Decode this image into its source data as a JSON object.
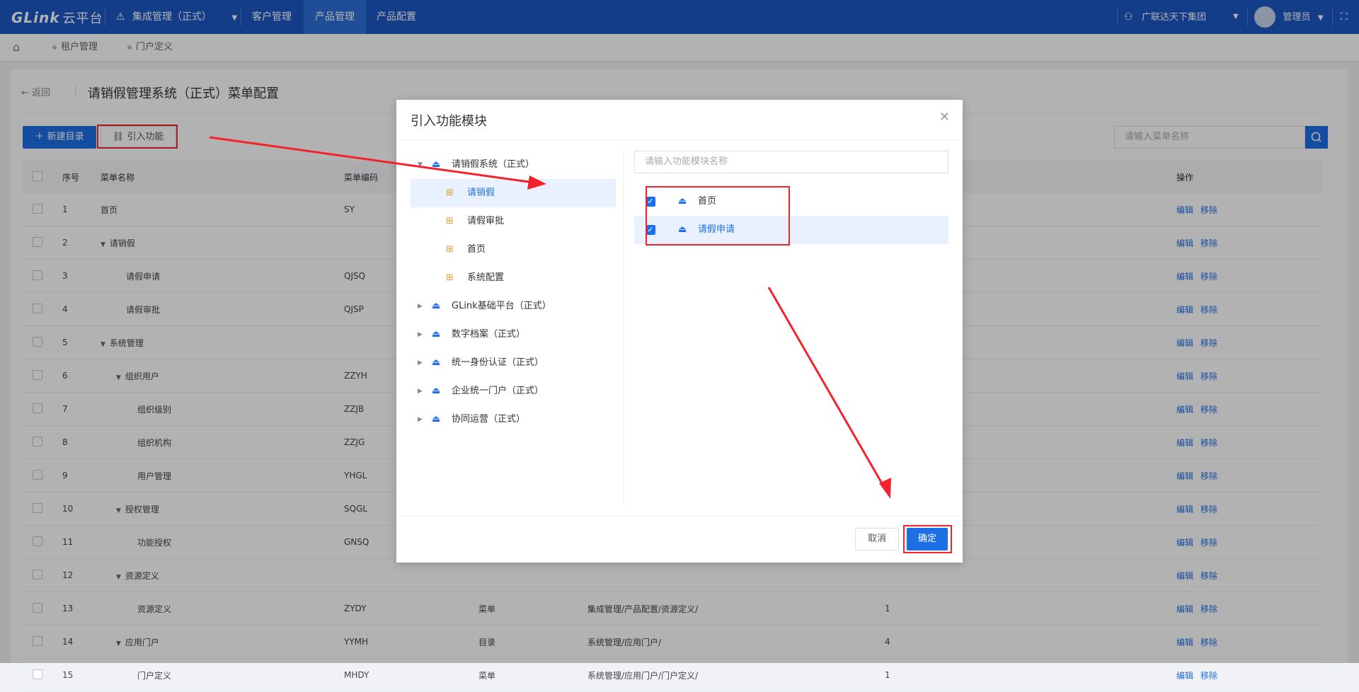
{
  "topbar": {
    "logo": "GLink",
    "logo_suffix": "云平台",
    "app_switch": "集成管理（正式）",
    "nav": [
      "客户管理",
      "产品管理",
      "产品配置"
    ],
    "active_nav": "产品管理",
    "org": "广联达天下集团",
    "user": "管理员"
  },
  "tabs": [
    "租户管理",
    "门户定义"
  ],
  "page": {
    "back": "返回",
    "title": "请销假管理系统（正式）菜单配置",
    "new_btn": "新建目录",
    "import_btn": "引入功能",
    "search_placeholder": "请输入菜单名称"
  },
  "table": {
    "headers": [
      "序号",
      "菜单名称",
      "菜单编码",
      "",
      "",
      "",
      "操作"
    ],
    "rows": [
      {
        "no": "1",
        "name": "首页",
        "level": 0,
        "expand": false,
        "code": "SY",
        "type": "",
        "path": "",
        "sort": ""
      },
      {
        "no": "2",
        "name": "请销假",
        "level": 0,
        "expand": true,
        "code": "",
        "type": "",
        "path": "",
        "sort": ""
      },
      {
        "no": "3",
        "name": "请假申请",
        "level": 1,
        "expand": false,
        "code": "QJSQ",
        "type": "",
        "path": "",
        "sort": ""
      },
      {
        "no": "4",
        "name": "请假审批",
        "level": 1,
        "expand": false,
        "code": "QJSP",
        "type": "",
        "path": "",
        "sort": ""
      },
      {
        "no": "5",
        "name": "系统管理",
        "level": 0,
        "expand": true,
        "code": "",
        "type": "",
        "path": "",
        "sort": ""
      },
      {
        "no": "6",
        "name": "组织用户",
        "level": 1,
        "expand": true,
        "code": "ZZYH",
        "type": "",
        "path": "",
        "sort": ""
      },
      {
        "no": "7",
        "name": "组织级别",
        "level": 2,
        "expand": false,
        "code": "ZZJB",
        "type": "",
        "path": "",
        "sort": ""
      },
      {
        "no": "8",
        "name": "组织机构",
        "level": 2,
        "expand": false,
        "code": "ZZJG",
        "type": "",
        "path": "",
        "sort": ""
      },
      {
        "no": "9",
        "name": "用户管理",
        "level": 2,
        "expand": false,
        "code": "YHGL",
        "type": "",
        "path": "",
        "sort": ""
      },
      {
        "no": "10",
        "name": "授权管理",
        "level": 1,
        "expand": true,
        "code": "SQGL",
        "type": "",
        "path": "",
        "sort": ""
      },
      {
        "no": "11",
        "name": "功能授权",
        "level": 2,
        "expand": false,
        "code": "GNSQ",
        "type": "",
        "path": "",
        "sort": ""
      },
      {
        "no": "12",
        "name": "资源定义",
        "level": 1,
        "expand": true,
        "code": "",
        "type": "",
        "path": "",
        "sort": ""
      },
      {
        "no": "13",
        "name": "资源定义",
        "level": 2,
        "expand": false,
        "code": "ZYDY",
        "type": "菜单",
        "path": "集成管理/产品配置/资源定义/",
        "sort": "1"
      },
      {
        "no": "14",
        "name": "应用门户",
        "level": 1,
        "expand": true,
        "code": "YYMH",
        "type": "目录",
        "path": "系统管理/应用门户/",
        "sort": "4"
      },
      {
        "no": "15",
        "name": "门户定义",
        "level": 2,
        "expand": false,
        "code": "MHDY",
        "type": "菜单",
        "path": "系统管理/应用门户/门户定义/",
        "sort": "1"
      }
    ],
    "edit": "编辑",
    "remove": "移除"
  },
  "dialog": {
    "title": "引入功能模块",
    "tree": [
      {
        "label": "请销假系统（正式）",
        "level": 0,
        "expanded": true,
        "selected": false,
        "kind": "system"
      },
      {
        "label": "请销假",
        "level": 1,
        "expanded": false,
        "selected": true,
        "kind": "module"
      },
      {
        "label": "请假审批",
        "level": 1,
        "expanded": false,
        "selected": false,
        "kind": "module"
      },
      {
        "label": "首页",
        "level": 1,
        "expanded": false,
        "selected": false,
        "kind": "module"
      },
      {
        "label": "系统配置",
        "level": 1,
        "expanded": false,
        "selected": false,
        "kind": "module"
      },
      {
        "label": "GLink基础平台（正式）",
        "level": 0,
        "expanded": false,
        "selected": false,
        "kind": "system"
      },
      {
        "label": "数字档案（正式）",
        "level": 0,
        "expanded": false,
        "selected": false,
        "kind": "system"
      },
      {
        "label": "统一身份认证（正式）",
        "level": 0,
        "expanded": false,
        "selected": false,
        "kind": "system"
      },
      {
        "label": "企业统一门户（正式）",
        "level": 0,
        "expanded": false,
        "selected": false,
        "kind": "system"
      },
      {
        "label": "协同运营（正式）",
        "level": 0,
        "expanded": false,
        "selected": false,
        "kind": "system"
      }
    ],
    "filter_placeholder": "请输入功能模块名称",
    "items": [
      {
        "label": "首页",
        "checked": true,
        "selected": false
      },
      {
        "label": "请假申请",
        "checked": true,
        "selected": true
      }
    ],
    "cancel": "取消",
    "ok": "确定"
  },
  "colors": {
    "brand": "#1e58c4",
    "primary": "#1e6fe6",
    "annotation": "#f5222d"
  }
}
